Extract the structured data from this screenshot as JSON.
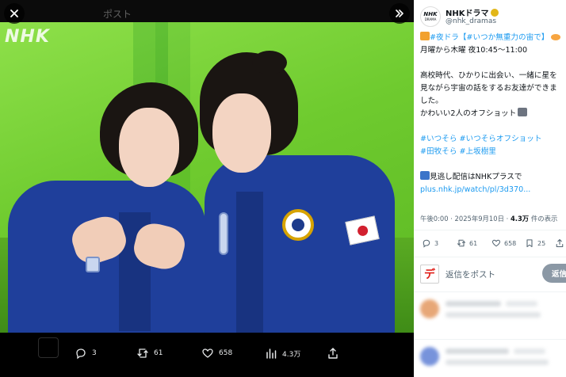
{
  "viewer": {
    "watermark": "NHK",
    "top_hint": "ポスト",
    "close_icon": "close-icon",
    "expand_icon": "chevrons-right-icon",
    "actions": {
      "reply_count": "3",
      "repost_count": "61",
      "like_count": "658",
      "views_count": "4.3万"
    }
  },
  "post": {
    "author_name": "NHKドラマ",
    "author_handle": "@nhk_dramas",
    "avatar_text_main": "NHK",
    "avatar_text_sub": "DRAMA",
    "line1_tag1": "#夜ドラ",
    "line1_tag2": "【#いつか無重力の宙で】",
    "line2": "月曜から木曜 夜10:45～11:00",
    "para2": "高校時代、ひかりに出会い、一緒に星を見ながら宇宙の話をするお友達ができました。",
    "para3": "かわいい2人のオフショット",
    "hashtags_line1": "#いつそら #いつそらオフショット",
    "hashtags_line2": "#田牧そら #上坂樹里",
    "watch_text": "見逃し配信はNHKプラスで",
    "watch_link": "plus.nhk.jp/watch/pl/3d370...",
    "meta_time": "午後0:00 · 2025年9月10日 · ",
    "meta_views": "4.3万",
    "meta_views_label": " 件の表示",
    "stats": {
      "replies": "3",
      "reposts": "61",
      "likes": "658",
      "bookmarks": "25"
    },
    "reply_avatar_text": "デ",
    "reply_placeholder": "返信をポスト",
    "reply_button": "返信"
  },
  "colors": {
    "accent": "#1d9bf0",
    "green_screen": "#6fcb2f",
    "suit": "#1f3f9b",
    "verified": "#e2b719"
  }
}
